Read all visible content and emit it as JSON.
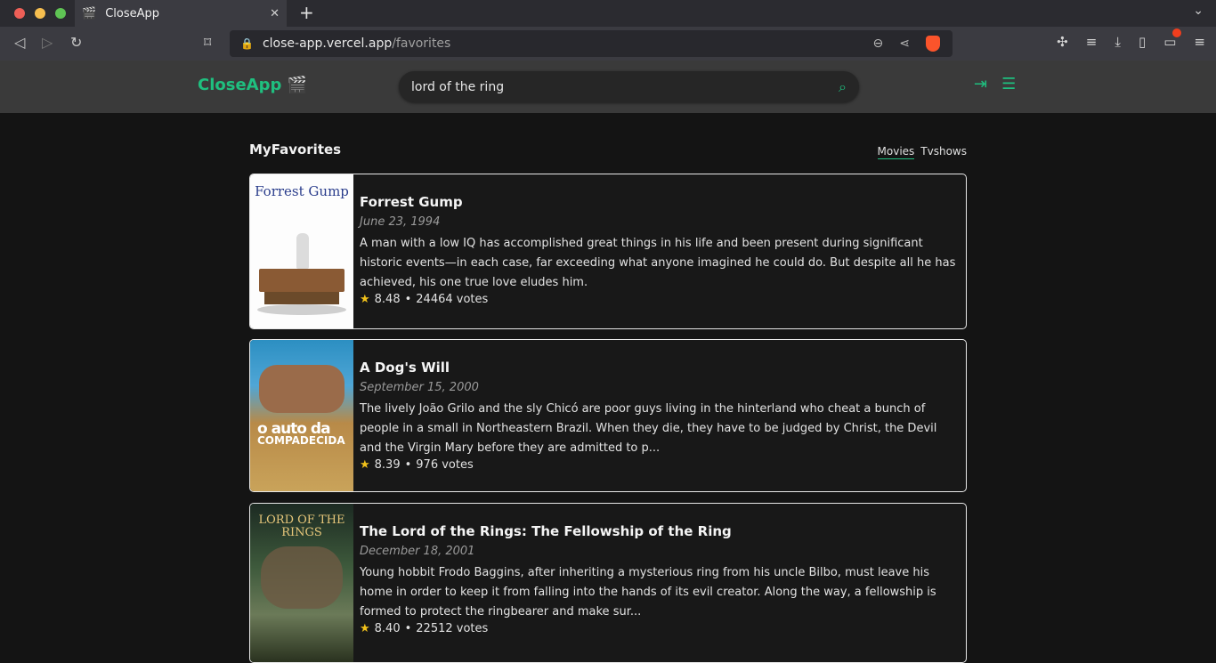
{
  "browser": {
    "tab_title": "CloseApp",
    "tab_favicon": "🎬",
    "url_host": "close-app.vercel.app",
    "url_path": "/favorites"
  },
  "app": {
    "logo": "CloseApp 🎬",
    "search_value": "lord of the ring",
    "accent": "#1fbf7f"
  },
  "page": {
    "title": "MyFavorites",
    "toggles": [
      "Movies",
      "Tvshows"
    ]
  },
  "movies": [
    {
      "title": "Forrest Gump",
      "date": "June 23, 1994",
      "overview": "A man with a low IQ has accomplished great things in his life and been present during significant historic events—in each case, far exceeding what anyone imagined he could do. But despite all he has achieved, his one true love eludes him.",
      "rating": "8.48",
      "votes": "24464 votes",
      "poster_text": "Forrest Gump"
    },
    {
      "title": "A Dog's Will",
      "date": "September 15, 2000",
      "overview": "The lively João Grilo and the sly Chicó are poor guys living in the hinterland who cheat a bunch of people in a small in Northeastern Brazil. When they die, they have to be judged by Christ, the Devil and the Virgin Mary before they are admitted to p...",
      "rating": "8.39",
      "votes": "976 votes",
      "poster_text_1": "o auto da",
      "poster_text_2": "COMPADECIDA"
    },
    {
      "title": "The Lord of the Rings: The Fellowship of the Ring",
      "date": "December 18, 2001",
      "overview": "Young hobbit Frodo Baggins, after inheriting a mysterious ring from his uncle Bilbo, must leave his home in order to keep it from falling into the hands of its evil creator. Along the way, a fellowship is formed to protect the ringbearer and make sur...",
      "rating": "8.40",
      "votes": "22512 votes",
      "poster_text": "LORD OF THE RINGS"
    }
  ]
}
